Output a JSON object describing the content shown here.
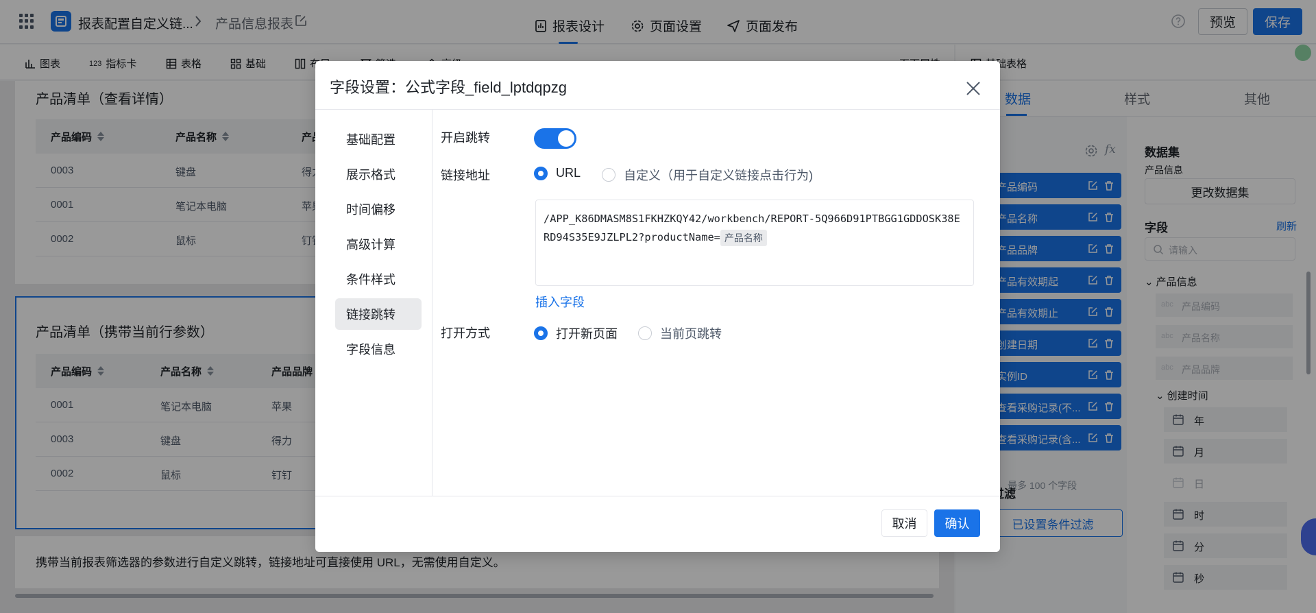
{
  "app": {
    "name": "报表配置自定义链...",
    "breadcrumb_current": "产品信息报表"
  },
  "top_tabs": [
    {
      "label": "报表设计",
      "icon": "report-design-icon",
      "active": true
    },
    {
      "label": "页面设置",
      "icon": "gear-icon",
      "active": false
    },
    {
      "label": "页面发布",
      "icon": "send-icon",
      "active": false
    }
  ],
  "header_actions": {
    "preview": "预览",
    "save": "保存"
  },
  "toolbar": {
    "items": [
      {
        "label": "图表",
        "icon": "bar-chart-icon"
      },
      {
        "label": "指标卡",
        "icon": "metric-card-icon"
      },
      {
        "label": "表格",
        "icon": "table-icon"
      },
      {
        "label": "基础",
        "icon": "basic-grid-icon"
      },
      {
        "label": "布局",
        "icon": "layout-icon"
      },
      {
        "label": "筛选",
        "icon": "filter-icon"
      },
      {
        "label": "高级",
        "icon": "advanced-icon"
      }
    ],
    "page_props": "页面属性",
    "right_label": "基础表格"
  },
  "cards": {
    "top": {
      "title": "产品清单（查看详情）",
      "headers": [
        "产品编码",
        "产品名称",
        "产品"
      ],
      "rows": [
        [
          "0003",
          "键盘",
          "得力"
        ],
        [
          "0001",
          "笔记本电脑",
          "苹果"
        ],
        [
          "0002",
          "鼠标",
          "钉钉"
        ]
      ]
    },
    "bottom": {
      "title": "产品清单（携带当前行参数）",
      "headers": [
        "产品编码",
        "产品名称",
        "产品品牌"
      ],
      "rows": [
        [
          "0001",
          "笔记本电脑",
          "苹果"
        ],
        [
          "0003",
          "键盘",
          "得力"
        ],
        [
          "0002",
          "鼠标",
          "钉钉"
        ]
      ]
    },
    "hint": "携带当前报表筛选器的参数进行自定义跳转，链接地址可直接使用 URL，无需使用自定义。"
  },
  "right_panel": {
    "tabs": [
      "数据",
      "样式",
      "其他"
    ],
    "field_chips": [
      "产品编码",
      "产品名称",
      "产品品牌",
      "产品有效期起",
      "产品有效期止",
      "创建日期",
      "实例ID",
      "查看采购记录(不...",
      "查看采购记录(含..."
    ],
    "max_note": "最多 100 个字段",
    "filter_title": "过滤",
    "filter_button": "已设置条件过滤",
    "dataset_title": "数据集",
    "dataset_name": "产品信息",
    "change_dataset": "更改数据集",
    "fields_title": "字段",
    "refresh": "刷新",
    "search_placeholder": "请输入",
    "tree_group": "产品信息",
    "tree_items": [
      "产品编码",
      "产品名称",
      "产品品牌"
    ],
    "abc": "abc",
    "date_group": "创建时间",
    "date_parts": [
      "年",
      "月",
      "日",
      "时",
      "分",
      "秒"
    ]
  },
  "modal": {
    "title": "字段设置：公式字段_field_lptdqpzg",
    "nav": [
      "基础配置",
      "展示格式",
      "时间偏移",
      "高级计算",
      "条件样式",
      "链接跳转",
      "字段信息"
    ],
    "active_nav": "链接跳转",
    "enable_jump_label": "开启跳转",
    "enable_jump": true,
    "link_label": "链接地址",
    "link_options": [
      "URL",
      "自定义（用于自定义链接点击行为)"
    ],
    "link_selected": "URL",
    "url_text": "/APP_K86DMASM8S1FKHZKQY42/workbench/REPORT-5Q966D91PTBGG1GDDOSK38ERD94S35E9JZLPL2?productName=",
    "url_field_tag": "产品名称",
    "insert_field": "插入字段",
    "open_label": "打开方式",
    "open_options": [
      "打开新页面",
      "当前页跳转"
    ],
    "open_selected": "打开新页面",
    "cancel": "取消",
    "confirm": "确认"
  },
  "colors": {
    "primary": "#1a73e8",
    "mask": "rgba(0,0,0,0.4)"
  }
}
